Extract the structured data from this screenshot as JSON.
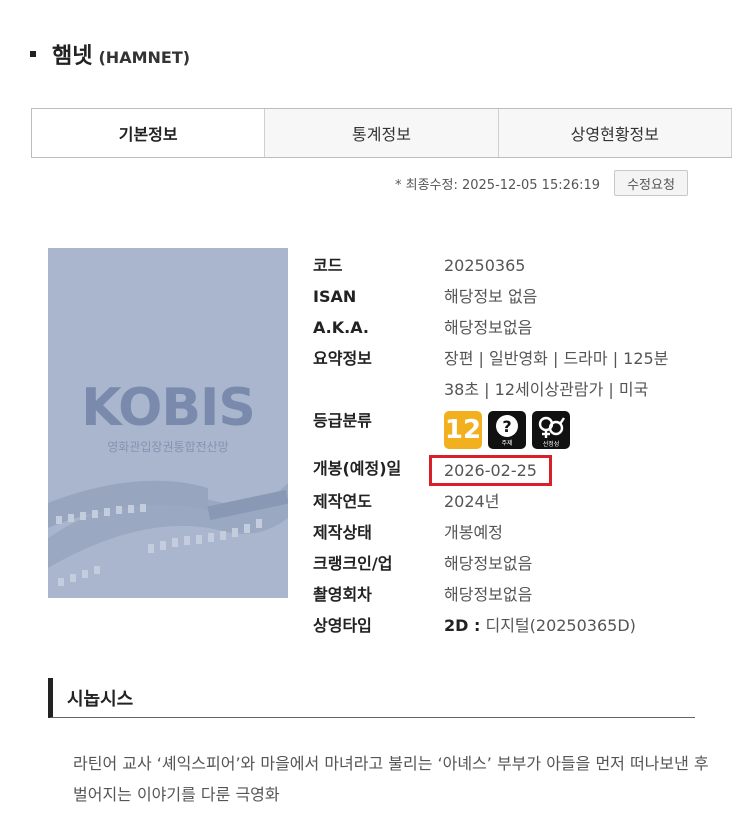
{
  "title": {
    "main": "햄넷",
    "english": "(HAMNET)"
  },
  "tabs": [
    {
      "label": "기본정보",
      "active": true
    },
    {
      "label": "통계정보",
      "active": false
    },
    {
      "label": "상영현황정보",
      "active": false
    }
  ],
  "revision": {
    "text": "* 최종수정: 2025-12-05 15:26:19",
    "button": "수정요청"
  },
  "poster": {
    "logo": "KOBIS",
    "subtitle": "영화관입장권통합전산망"
  },
  "info": {
    "code": {
      "label": "코드",
      "value": "20250365"
    },
    "isan": {
      "label": "ISAN",
      "value": "해당정보 없음"
    },
    "aka": {
      "label": "A.K.A.",
      "value": "해당정보없음"
    },
    "summary": {
      "label": "요약정보",
      "value": "장편 | 일반영화 | 드라마 | 125분 38초 | 12세이상관람가 | 미국"
    },
    "rating": {
      "label": "등급분류",
      "age": "12",
      "icon2": "question-theme-icon",
      "icon3": "gender-sexual-icon",
      "icon2_caption": "주제",
      "icon3_caption": "선정성"
    },
    "release": {
      "label": "개봉(예정)일",
      "value": "2026-02-25"
    },
    "year": {
      "label": "제작연도",
      "value": "2024년"
    },
    "status": {
      "label": "제작상태",
      "value": "개봉예정"
    },
    "crankin": {
      "label": "크랭크인/업",
      "value": "해당정보없음"
    },
    "shots": {
      "label": "촬영회차",
      "value": "해당정보없음"
    },
    "screening": {
      "label": "상영타입",
      "type": "2D :",
      "value": "디지털(20250365D)"
    }
  },
  "synopsis": {
    "heading": "시놉시스",
    "text": "라틴어 교사 ‘셰익스피어’와 마을에서 마녀라고 불리는 ‘아녜스’ 부부가 아들을 먼저 떠나보낸 후 벌어지는 이야기를 다룬 극영화"
  }
}
